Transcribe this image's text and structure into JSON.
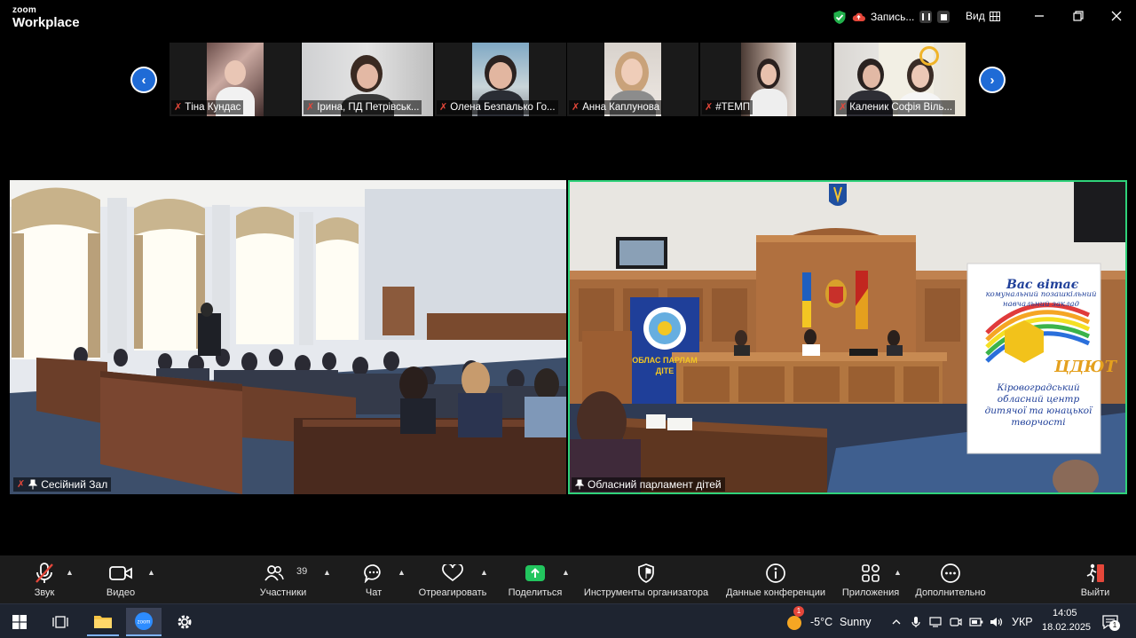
{
  "app": {
    "logo_top": "zoom",
    "logo_bottom": "Workplace"
  },
  "titlebar": {
    "recording_label": "Запись...",
    "view_label": "Вид"
  },
  "thumbnails": [
    {
      "name": "Тіна Кундас"
    },
    {
      "name": "Ірина, ПД Петрівськ..."
    },
    {
      "name": "Олена Безпалько Го..."
    },
    {
      "name": "Анна Каплунова"
    },
    {
      "name": "#ТЕМП"
    },
    {
      "name": "Каленик Софія Віль..."
    }
  ],
  "main_videos": [
    {
      "name": "Сесійний Зал"
    },
    {
      "name": "Обласний парламент дітей"
    }
  ],
  "banner": {
    "top_text": "Вас вітає",
    "sub_text": "комунальний позашкільний навчальний заклад",
    "logo_text": "ЦДЮТ",
    "bottom_text": "Кіровоградський обласний центр дитячої та юнацької творчості",
    "left_banner_text": "ОБЛАС ПАРЛАМ ДІТЕ"
  },
  "toolbar": {
    "audio": "Звук",
    "video": "Видео",
    "participants": "Участники",
    "participants_count": "39",
    "chat": "Чат",
    "react": "Отреагировать",
    "share": "Поделиться",
    "host_tools": "Инструменты организатора",
    "meeting_info": "Данные конференции",
    "apps": "Приложения",
    "more": "Дополнительно",
    "leave": "Выйти"
  },
  "taskbar": {
    "weather_temp": "-5°C",
    "weather_text": "Sunny",
    "weather_badge": "1",
    "language": "УКР",
    "time": "14:05",
    "date": "18.02.2025",
    "notification_count": "1"
  },
  "colors": {
    "accent_blue": "#1f6bd6",
    "active_speaker": "#2fd27a",
    "mic_muted": "#e5473a",
    "share_green": "#22c55e"
  }
}
